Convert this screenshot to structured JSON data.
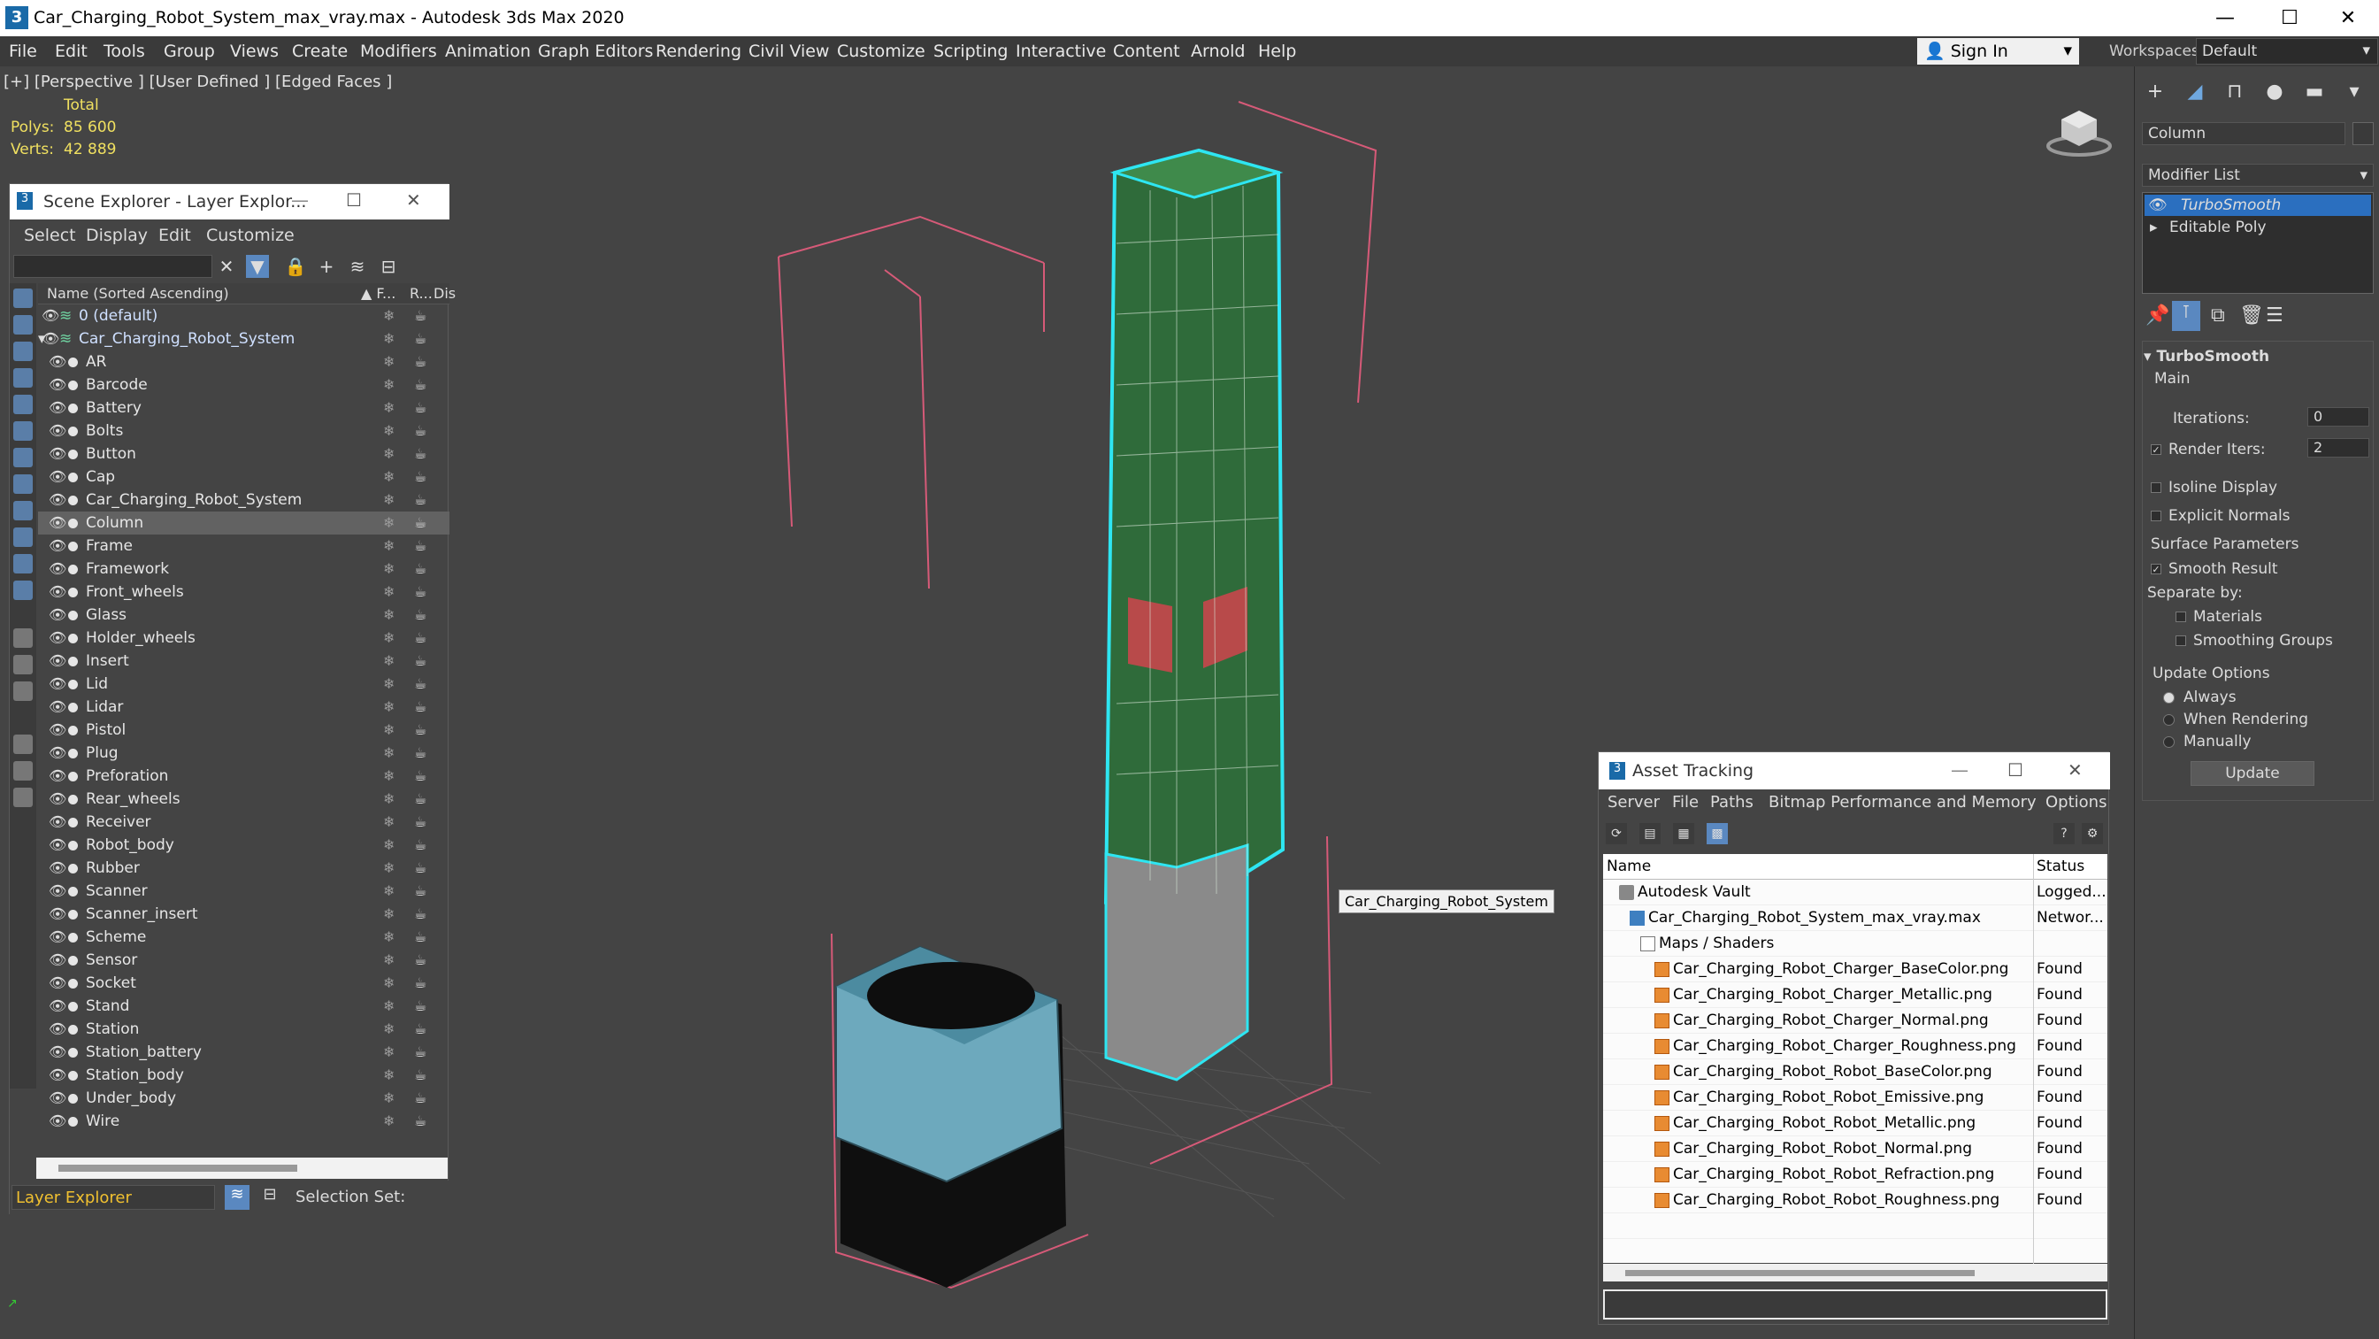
{
  "titlebar": {
    "title": "Car_Charging_Robot_System_max_vray.max - Autodesk 3ds Max 2020",
    "app_icon": "3",
    "minimize": "—",
    "maximize": "☐",
    "close": "✕"
  },
  "menu": [
    "File",
    "Edit",
    "Tools",
    "Group",
    "Views",
    "Create",
    "Modifiers",
    "Animation",
    "Graph Editors",
    "Rendering",
    "Civil View",
    "Customize",
    "Scripting",
    "Interactive",
    "Content",
    "Arnold",
    "Help"
  ],
  "signin": {
    "label": "Sign In"
  },
  "workspaces": {
    "label": "Workspaces:",
    "value": "Default"
  },
  "viewport": {
    "label": "[+] [Perspective ] [User Defined ] [Edged Faces ]",
    "stats_header": "Total",
    "polys_label": "Polys:",
    "polys_value": "85 600",
    "verts_label": "Verts:",
    "verts_value": "42 889",
    "tooltip": "Car_Charging_Robot_System"
  },
  "scene_explorer": {
    "title": "Scene Explorer - Layer Explor...",
    "menu": [
      "Select",
      "Display",
      "Edit",
      "Customize"
    ],
    "col_name": "Name (Sorted Ascending)",
    "col_frozen": "▲ F...",
    "col_render": "R...",
    "col_display": "Dis",
    "layers": [
      {
        "name": "0 (default)"
      },
      {
        "name": "Car_Charging_Robot_System"
      }
    ],
    "objects": [
      "AR",
      "Barcode",
      "Battery",
      "Bolts",
      "Button",
      "Cap",
      "Car_Charging_Robot_System",
      "Column",
      "Frame",
      "Framework",
      "Front_wheels",
      "Glass",
      "Holder_wheels",
      "Insert",
      "Lid",
      "Lidar",
      "Pistol",
      "Plug",
      "Preforation",
      "Rear_wheels",
      "Receiver",
      "Robot_body",
      "Rubber",
      "Scanner",
      "Scanner_insert",
      "Scheme",
      "Sensor",
      "Socket",
      "Stand",
      "Station",
      "Station_battery",
      "Station_body",
      "Under_body",
      "Wire"
    ],
    "selected": "Column",
    "bottom_dropdown": "Layer Explorer",
    "selection_set_label": "Selection Set:"
  },
  "command_panel": {
    "object_name": "Column",
    "modifier_list": "Modifier List",
    "stack": [
      "TurboSmooth",
      "Editable Poly"
    ],
    "rollout_title": "TurboSmooth",
    "main_label": "Main",
    "iterations_label": "Iterations:",
    "iterations_value": "0",
    "render_iters_label": "Render Iters:",
    "render_iters_value": "2",
    "isoline": "Isoline Display",
    "explicit_normals": "Explicit Normals",
    "surface_params": "Surface Parameters",
    "smooth_result": "Smooth Result",
    "separate_by": "Separate by:",
    "materials": "Materials",
    "smoothing_groups": "Smoothing Groups",
    "update_options": "Update Options",
    "always": "Always",
    "when_rendering": "When Rendering",
    "manually": "Manually",
    "update_button": "Update"
  },
  "asset_tracking": {
    "title": "Asset Tracking",
    "menu": [
      "Server",
      "File",
      "Paths",
      "Bitmap Performance and Memory",
      "Options"
    ],
    "col_name": "Name",
    "col_status": "Status",
    "rows": [
      {
        "name": "Autodesk Vault",
        "status": "Logged..."
      },
      {
        "name": "Car_Charging_Robot_System_max_vray.max",
        "status": "Networ..."
      },
      {
        "name": "Maps / Shaders",
        "status": ""
      },
      {
        "name": "Car_Charging_Robot_Charger_BaseColor.png",
        "status": "Found"
      },
      {
        "name": "Car_Charging_Robot_Charger_Metallic.png",
        "status": "Found"
      },
      {
        "name": "Car_Charging_Robot_Charger_Normal.png",
        "status": "Found"
      },
      {
        "name": "Car_Charging_Robot_Charger_Roughness.png",
        "status": "Found"
      },
      {
        "name": "Car_Charging_Robot_Robot_BaseColor.png",
        "status": "Found"
      },
      {
        "name": "Car_Charging_Robot_Robot_Emissive.png",
        "status": "Found"
      },
      {
        "name": "Car_Charging_Robot_Robot_Metallic.png",
        "status": "Found"
      },
      {
        "name": "Car_Charging_Robot_Robot_Normal.png",
        "status": "Found"
      },
      {
        "name": "Car_Charging_Robot_Robot_Refraction.png",
        "status": "Found"
      },
      {
        "name": "Car_Charging_Robot_Robot_Roughness.png",
        "status": "Found"
      }
    ]
  },
  "colors": {
    "selection_cyan": "#2ee6f2",
    "column_green": "#2f6b3a",
    "bbox_pink": "#d65a78",
    "stat_yellow": "#f0e060",
    "layer_explorer_orange": "#f0c030",
    "active_stack_blue": "#2b6fbf"
  }
}
